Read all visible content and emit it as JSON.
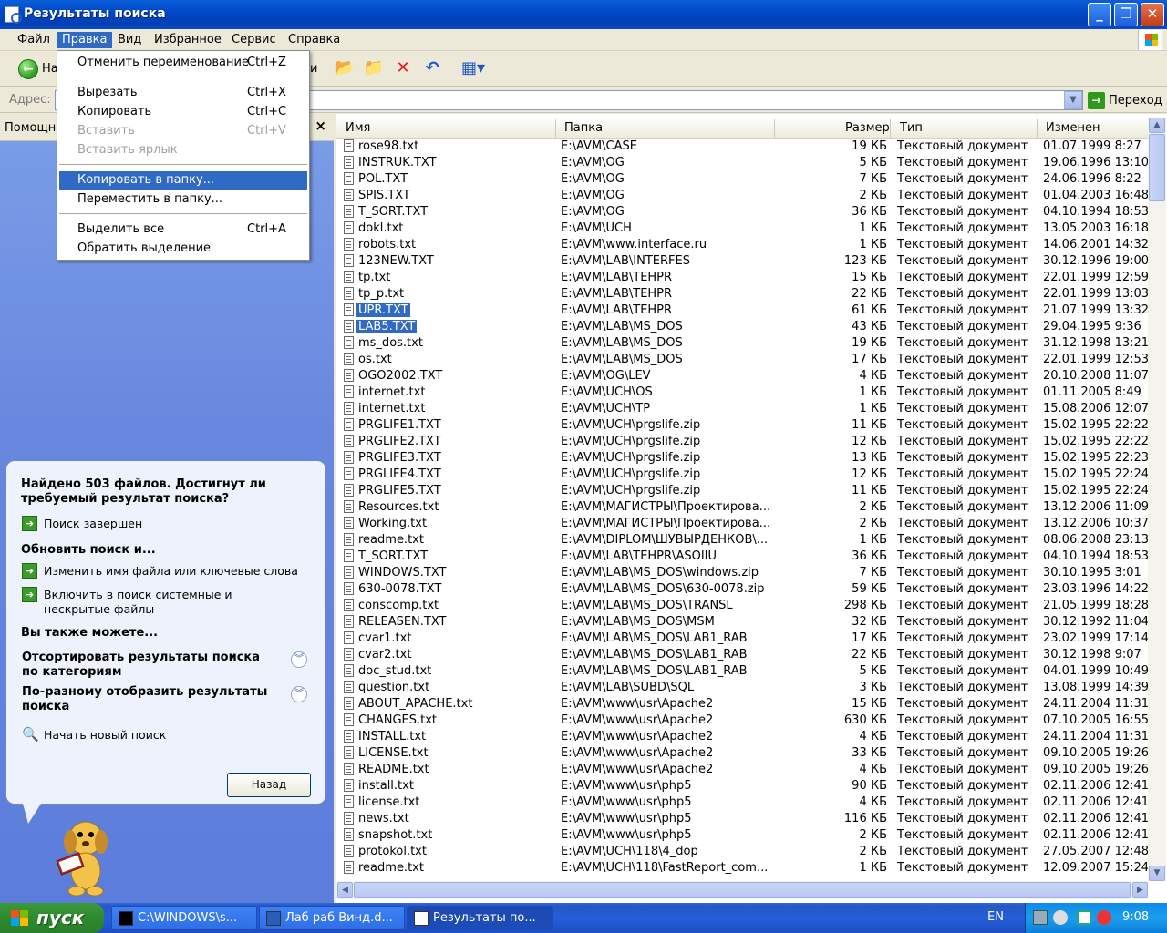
{
  "window": {
    "title": "Результаты поиска"
  },
  "menubar": {
    "items": [
      "Файл",
      "Правка",
      "Вид",
      "Избранное",
      "Сервис",
      "Справка"
    ],
    "active": "Правка"
  },
  "toolbar": {
    "back_label": "На",
    "partial_label": "и"
  },
  "address": {
    "label": "Адрес:",
    "value": "",
    "go_label": "Переход"
  },
  "left_pane": {
    "header": "Помощні",
    "found_text": "Найдено 503 файлов. Достигнут ли требуемый результат поиска?",
    "search_done": "Поиск завершен",
    "refine_title": "Обновить поиск и...",
    "change_name": "Изменить имя файла или ключевые слова",
    "include_hidden": "Включить в поиск системные и нескрытые файлы",
    "also_title": "Вы также можете...",
    "sort_categories": "Отсортировать результаты поиска по категориям",
    "display_differently": "По-разному отобразить результаты поиска",
    "new_search": "Начать новый поиск",
    "back_button": "Назад"
  },
  "edit_menu": {
    "undo": {
      "label": "Отменить переименование",
      "shortcut": "Ctrl+Z"
    },
    "cut": {
      "label": "Вырезать",
      "shortcut": "Ctrl+X"
    },
    "copy": {
      "label": "Копировать",
      "shortcut": "Ctrl+C"
    },
    "paste": {
      "label": "Вставить",
      "shortcut": "Ctrl+V"
    },
    "paste_shortcut": {
      "label": "Вставить ярлык",
      "shortcut": ""
    },
    "copy_to": {
      "label": "Копировать в папку...",
      "shortcut": ""
    },
    "move_to": {
      "label": "Переместить в папку...",
      "shortcut": ""
    },
    "select_all": {
      "label": "Выделить все",
      "shortcut": "Ctrl+A"
    },
    "invert": {
      "label": "Обратить выделение",
      "shortcut": ""
    }
  },
  "columns": {
    "name": "Имя",
    "folder": "Папка",
    "size": "Размер",
    "type": "Тип",
    "modified": "Изменен"
  },
  "files": [
    {
      "name": "rose98.txt",
      "folder": "E:\\AVM\\CASE",
      "size": "19 КБ",
      "type": "Текстовый документ",
      "modified": "01.07.1999 8:27",
      "selected": false
    },
    {
      "name": "INSTRUK.TXT",
      "folder": "E:\\AVM\\OG",
      "size": "5 КБ",
      "type": "Текстовый документ",
      "modified": "19.06.1996 13:10",
      "selected": false
    },
    {
      "name": "POL.TXT",
      "folder": "E:\\AVM\\OG",
      "size": "7 КБ",
      "type": "Текстовый документ",
      "modified": "24.06.1996 8:22",
      "selected": false
    },
    {
      "name": "SPIS.TXT",
      "folder": "E:\\AVM\\OG",
      "size": "2 КБ",
      "type": "Текстовый документ",
      "modified": "01.04.2003 16:48",
      "selected": false
    },
    {
      "name": "T_SORT.TXT",
      "folder": "E:\\AVM\\OG",
      "size": "36 КБ",
      "type": "Текстовый документ",
      "modified": "04.10.1994 18:53",
      "selected": false
    },
    {
      "name": "dokl.txt",
      "folder": "E:\\AVM\\UCH",
      "size": "1 КБ",
      "type": "Текстовый документ",
      "modified": "13.05.2003 16:18",
      "selected": false
    },
    {
      "name": "robots.txt",
      "folder": "E:\\AVM\\www.interface.ru",
      "size": "1 КБ",
      "type": "Текстовый документ",
      "modified": "14.06.2001 14:32",
      "selected": false
    },
    {
      "name": "123NEW.TXT",
      "folder": "E:\\AVM\\LAB\\INTERFES",
      "size": "123 КБ",
      "type": "Текстовый документ",
      "modified": "30.12.1996 19:00",
      "selected": false
    },
    {
      "name": "tp.txt",
      "folder": "E:\\AVM\\LAB\\TEHPR",
      "size": "15 КБ",
      "type": "Текстовый документ",
      "modified": "22.01.1999 12:59",
      "selected": false
    },
    {
      "name": "tp_p.txt",
      "folder": "E:\\AVM\\LAB\\TEHPR",
      "size": "22 КБ",
      "type": "Текстовый документ",
      "modified": "22.01.1999 13:03",
      "selected": false
    },
    {
      "name": "UPR.TXT",
      "folder": "E:\\AVM\\LAB\\TEHPR",
      "size": "61 КБ",
      "type": "Текстовый документ",
      "modified": "21.07.1999 13:32",
      "selected": true
    },
    {
      "name": "LAB5.TXT",
      "folder": "E:\\AVM\\LAB\\MS_DOS",
      "size": "43 КБ",
      "type": "Текстовый документ",
      "modified": "29.04.1995 9:36",
      "selected": true
    },
    {
      "name": "ms_dos.txt",
      "folder": "E:\\AVM\\LAB\\MS_DOS",
      "size": "19 КБ",
      "type": "Текстовый документ",
      "modified": "31.12.1998 13:21",
      "selected": false
    },
    {
      "name": "os.txt",
      "folder": "E:\\AVM\\LAB\\MS_DOS",
      "size": "17 КБ",
      "type": "Текстовый документ",
      "modified": "22.01.1999 12:53",
      "selected": false
    },
    {
      "name": "OGO2002.TXT",
      "folder": "E:\\AVM\\OG\\LEV",
      "size": "4 КБ",
      "type": "Текстовый документ",
      "modified": "20.10.2008 11:07",
      "selected": false
    },
    {
      "name": "internet.txt",
      "folder": "E:\\AVM\\UCH\\OS",
      "size": "1 КБ",
      "type": "Текстовый документ",
      "modified": "01.11.2005 8:49",
      "selected": false
    },
    {
      "name": "internet.txt",
      "folder": "E:\\AVM\\UCH\\TP",
      "size": "1 КБ",
      "type": "Текстовый документ",
      "modified": "15.08.2006 12:07",
      "selected": false
    },
    {
      "name": "PRGLIFE1.TXT",
      "folder": "E:\\AVM\\UCH\\prgslife.zip",
      "size": "11 КБ",
      "type": "Текстовый документ",
      "modified": "15.02.1995 22:22",
      "selected": false
    },
    {
      "name": "PRGLIFE2.TXT",
      "folder": "E:\\AVM\\UCH\\prgslife.zip",
      "size": "12 КБ",
      "type": "Текстовый документ",
      "modified": "15.02.1995 22:22",
      "selected": false
    },
    {
      "name": "PRGLIFE3.TXT",
      "folder": "E:\\AVM\\UCH\\prgslife.zip",
      "size": "13 КБ",
      "type": "Текстовый документ",
      "modified": "15.02.1995 22:23",
      "selected": false
    },
    {
      "name": "PRGLIFE4.TXT",
      "folder": "E:\\AVM\\UCH\\prgslife.zip",
      "size": "12 КБ",
      "type": "Текстовый документ",
      "modified": "15.02.1995 22:24",
      "selected": false
    },
    {
      "name": "PRGLIFE5.TXT",
      "folder": "E:\\AVM\\UCH\\prgslife.zip",
      "size": "11 КБ",
      "type": "Текстовый документ",
      "modified": "15.02.1995 22:24",
      "selected": false
    },
    {
      "name": "Resources.txt",
      "folder": "E:\\AVM\\МАГИСТРЫ\\Проектирова...",
      "size": "2 КБ",
      "type": "Текстовый документ",
      "modified": "13.12.2006 11:09",
      "selected": false
    },
    {
      "name": "Working.txt",
      "folder": "E:\\AVM\\МАГИСТРЫ\\Проектирова...",
      "size": "2 КБ",
      "type": "Текстовый документ",
      "modified": "13.12.2006 10:37",
      "selected": false
    },
    {
      "name": "readme.txt",
      "folder": "E:\\AVM\\DIPLOM\\ШУВЫРДЕНКОВ\\...",
      "size": "1 КБ",
      "type": "Текстовый документ",
      "modified": "08.06.2008 23:13",
      "selected": false
    },
    {
      "name": "T_SORT.TXT",
      "folder": "E:\\AVM\\LAB\\TEHPR\\ASOIIU",
      "size": "36 КБ",
      "type": "Текстовый документ",
      "modified": "04.10.1994 18:53",
      "selected": false
    },
    {
      "name": "WINDOWS.TXT",
      "folder": "E:\\AVM\\LAB\\MS_DOS\\windows.zip",
      "size": "7 КБ",
      "type": "Текстовый документ",
      "modified": "30.10.1995 3:01",
      "selected": false
    },
    {
      "name": "630-0078.TXT",
      "folder": "E:\\AVM\\LAB\\MS_DOS\\630-0078.zip",
      "size": "59 КБ",
      "type": "Текстовый документ",
      "modified": "23.03.1996 14:22",
      "selected": false
    },
    {
      "name": "conscomp.txt",
      "folder": "E:\\AVM\\LAB\\MS_DOS\\TRANSL",
      "size": "298 КБ",
      "type": "Текстовый документ",
      "modified": "21.05.1999 18:28",
      "selected": false
    },
    {
      "name": "RELEASEN.TXT",
      "folder": "E:\\AVM\\LAB\\MS_DOS\\MSM",
      "size": "32 КБ",
      "type": "Текстовый документ",
      "modified": "30.12.1992 11:04",
      "selected": false
    },
    {
      "name": "cvar1.txt",
      "folder": "E:\\AVM\\LAB\\MS_DOS\\LAB1_RAB",
      "size": "17 КБ",
      "type": "Текстовый документ",
      "modified": "23.02.1999 17:14",
      "selected": false
    },
    {
      "name": "cvar2.txt",
      "folder": "E:\\AVM\\LAB\\MS_DOS\\LAB1_RAB",
      "size": "22 КБ",
      "type": "Текстовый документ",
      "modified": "30.12.1998 9:07",
      "selected": false
    },
    {
      "name": "doc_stud.txt",
      "folder": "E:\\AVM\\LAB\\MS_DOS\\LAB1_RAB",
      "size": "5 КБ",
      "type": "Текстовый документ",
      "modified": "04.01.1999 10:49",
      "selected": false
    },
    {
      "name": "question.txt",
      "folder": "E:\\AVM\\LAB\\SUBD\\SQL",
      "size": "3 КБ",
      "type": "Текстовый документ",
      "modified": "13.08.1999 14:39",
      "selected": false
    },
    {
      "name": "ABOUT_APACHE.txt",
      "folder": "E:\\AVM\\www\\usr\\Apache2",
      "size": "15 КБ",
      "type": "Текстовый документ",
      "modified": "24.11.2004 11:31",
      "selected": false
    },
    {
      "name": "CHANGES.txt",
      "folder": "E:\\AVM\\www\\usr\\Apache2",
      "size": "630 КБ",
      "type": "Текстовый документ",
      "modified": "07.10.2005 16:55",
      "selected": false
    },
    {
      "name": "INSTALL.txt",
      "folder": "E:\\AVM\\www\\usr\\Apache2",
      "size": "4 КБ",
      "type": "Текстовый документ",
      "modified": "24.11.2004 11:31",
      "selected": false
    },
    {
      "name": "LICENSE.txt",
      "folder": "E:\\AVM\\www\\usr\\Apache2",
      "size": "33 КБ",
      "type": "Текстовый документ",
      "modified": "09.10.2005 19:26",
      "selected": false
    },
    {
      "name": "README.txt",
      "folder": "E:\\AVM\\www\\usr\\Apache2",
      "size": "4 КБ",
      "type": "Текстовый документ",
      "modified": "09.10.2005 19:26",
      "selected": false
    },
    {
      "name": "install.txt",
      "folder": "E:\\AVM\\www\\usr\\php5",
      "size": "90 КБ",
      "type": "Текстовый документ",
      "modified": "02.11.2006 12:41",
      "selected": false
    },
    {
      "name": "license.txt",
      "folder": "E:\\AVM\\www\\usr\\php5",
      "size": "4 КБ",
      "type": "Текстовый документ",
      "modified": "02.11.2006 12:41",
      "selected": false
    },
    {
      "name": "news.txt",
      "folder": "E:\\AVM\\www\\usr\\php5",
      "size": "116 КБ",
      "type": "Текстовый документ",
      "modified": "02.11.2006 12:41",
      "selected": false
    },
    {
      "name": "snapshot.txt",
      "folder": "E:\\AVM\\www\\usr\\php5",
      "size": "2 КБ",
      "type": "Текстовый документ",
      "modified": "02.11.2006 12:41",
      "selected": false
    },
    {
      "name": "protokol.txt",
      "folder": "E:\\AVM\\UCH\\118\\4_dop",
      "size": "2 КБ",
      "type": "Текстовый документ",
      "modified": "27.05.2007 12:48",
      "selected": false
    },
    {
      "name": "readme.txt",
      "folder": "E:\\AVM\\UCH\\118\\FastReport_com...",
      "size": "1 КБ",
      "type": "Текстовый документ",
      "modified": "12.09.2007 15:24",
      "selected": false
    }
  ],
  "taskbar": {
    "start_label": "пуск",
    "tasks": [
      "C:\\WINDOWS\\s...",
      "Лаб раб Винд.d...",
      "Результаты по..."
    ],
    "lang": "EN",
    "clock": "9:08"
  }
}
